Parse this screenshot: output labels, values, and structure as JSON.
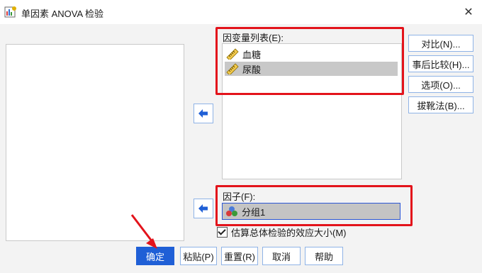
{
  "window": {
    "title": "单因素 ANOVA 检验",
    "close_glyph": "✕"
  },
  "dependent": {
    "label": "因变量列表(E):",
    "items": [
      "血糖",
      "尿酸"
    ]
  },
  "factor": {
    "label": "因子(F):",
    "value": "分组1"
  },
  "checkbox": {
    "label": "估算总体检验的效应大小(M)",
    "checked": true
  },
  "side_buttons": [
    "对比(N)...",
    "事后比较(H)...",
    "选项(O)...",
    "拔靴法(B)..."
  ],
  "bottom_buttons": {
    "ok": "确定",
    "paste": "粘贴(P)",
    "reset": "重置(R)",
    "cancel": "取消",
    "help": "帮助"
  },
  "colors": {
    "accent": "#1f5fd6",
    "highlight": "#e3131b",
    "selection": "#c8c8c8"
  },
  "icons": [
    "app-icon",
    "close-icon",
    "arrow-left-icon",
    "ruler-icon",
    "nominal-variable-icon",
    "checkmark-icon"
  ]
}
